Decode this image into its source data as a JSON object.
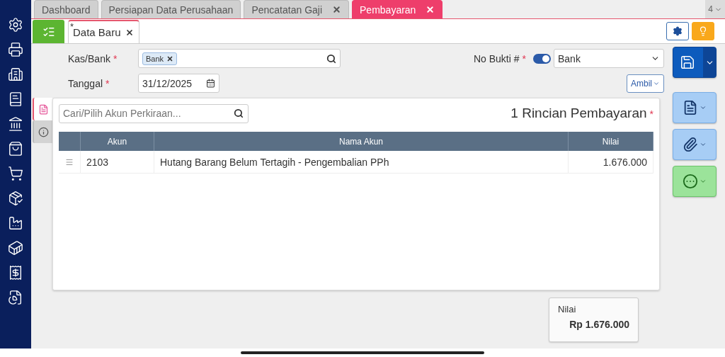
{
  "main_tabs": [
    {
      "label": "Dashboard",
      "closable": false,
      "selected": false
    },
    {
      "label": "Persiapan Data Perusahaan",
      "closable": false,
      "selected": false
    },
    {
      "label": "Pencatatan Gaji",
      "closable": true,
      "selected": false
    },
    {
      "label": "Pembayaran",
      "closable": true,
      "selected": true
    }
  ],
  "tab_overflow": {
    "count": "4"
  },
  "doc_tab": {
    "label": "Data Baru",
    "modified_mark": "*"
  },
  "form": {
    "kas_bank": {
      "label": "Kas/Bank",
      "required_mark": "*",
      "tags": [
        "Bank"
      ]
    },
    "tanggal": {
      "label": "Tanggal",
      "required_mark": "*",
      "value": "31/12/2025"
    },
    "no_bukti": {
      "label": "No Bukti #",
      "required_mark": "*",
      "auto": true,
      "value": "Bank"
    },
    "ambil_button": "Ambil"
  },
  "detail": {
    "side_tabs": [
      {
        "kind": "detail",
        "selected": true
      },
      {
        "kind": "info",
        "selected": false
      }
    ],
    "search_placeholder": "Cari/Pilih Akun Perkiraan...",
    "title": "1 Rincian Pembayaran",
    "required_mark": "*",
    "columns": [
      "Akun",
      "Nama Akun",
      "Nilai"
    ],
    "rows": [
      {
        "akun": "2103",
        "nama": "Hutang Barang Belum Tertagih - Pengembalian PPh",
        "nilai": "1.676.000"
      }
    ]
  },
  "total": {
    "label": "Nilai",
    "value": "Rp 1.676.000"
  }
}
